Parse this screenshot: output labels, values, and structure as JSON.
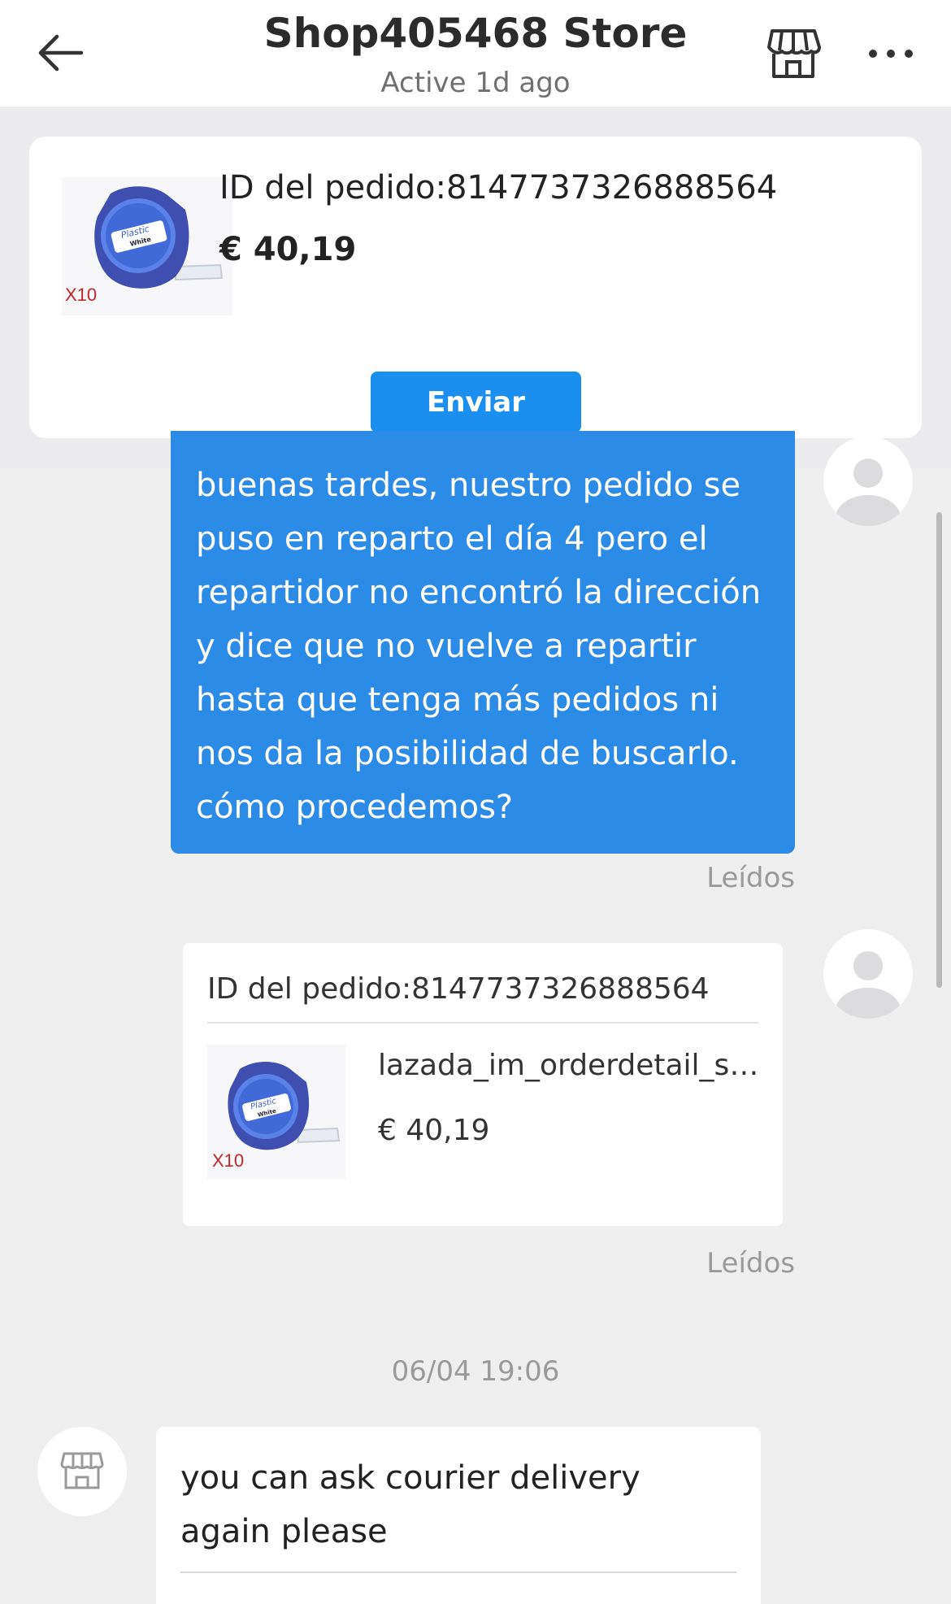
{
  "header": {
    "title": "Shop405468 Store",
    "subtitle": "Active 1d ago"
  },
  "pinned_order": {
    "order_id": "ID del pedido:8147737326888564",
    "price": "€ 40,19",
    "quantity_tag": "X10",
    "product_label_1": "Plastic",
    "product_label_2": "White",
    "send_label": "Enviar"
  },
  "messages": {
    "user_text": "buenas tardes, nuestro pedido se puso en reparto el día 4 pero el repartidor no encontró la dirección y dice que no vuelve a repartir hasta que tenga más pedidos ni nos da la posibilidad de buscarlo. cómo procedemos?",
    "read_status_1": "Leídos",
    "order_card": {
      "order_id": "ID del pedido:8147737326888564",
      "name": "lazada_im_orderdetail_status_text",
      "price": "€ 40,19",
      "quantity_tag": "X10",
      "product_label_1": "Plastic",
      "product_label_2": "White"
    },
    "read_status_2": "Leídos",
    "timestamp": "06/04 19:06",
    "store_text": "you can ask courier delivery again please"
  },
  "colors": {
    "accent": "#1a8ff0",
    "user_bubble": "#2b8be6",
    "background": "#efeff0"
  }
}
